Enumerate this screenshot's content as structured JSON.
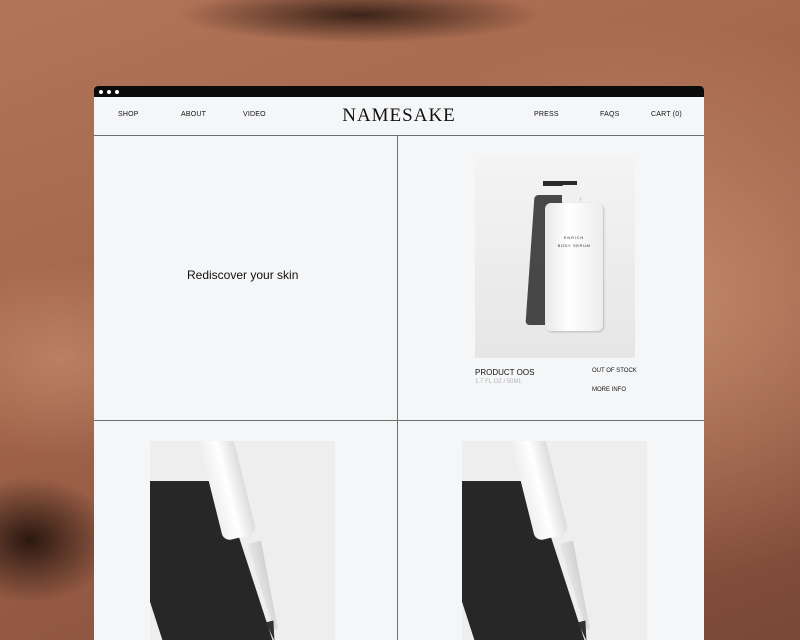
{
  "nav": {
    "left": [
      "SHOP",
      "ABOUT",
      "VIDEO"
    ],
    "brand": "NAMESAKE",
    "right": [
      "PRESS",
      "FAQS",
      "CART (0)"
    ]
  },
  "hero": {
    "tagline": "Rediscover your skin"
  },
  "product": {
    "name": "PRODUCT OOS",
    "size": "1.7 FL OZ / 50ML",
    "status": "OUT OF STOCK",
    "more": "MORE INFO",
    "bottle_label": "ENRICH",
    "bottle_sublabel": "BODY SERUM"
  }
}
